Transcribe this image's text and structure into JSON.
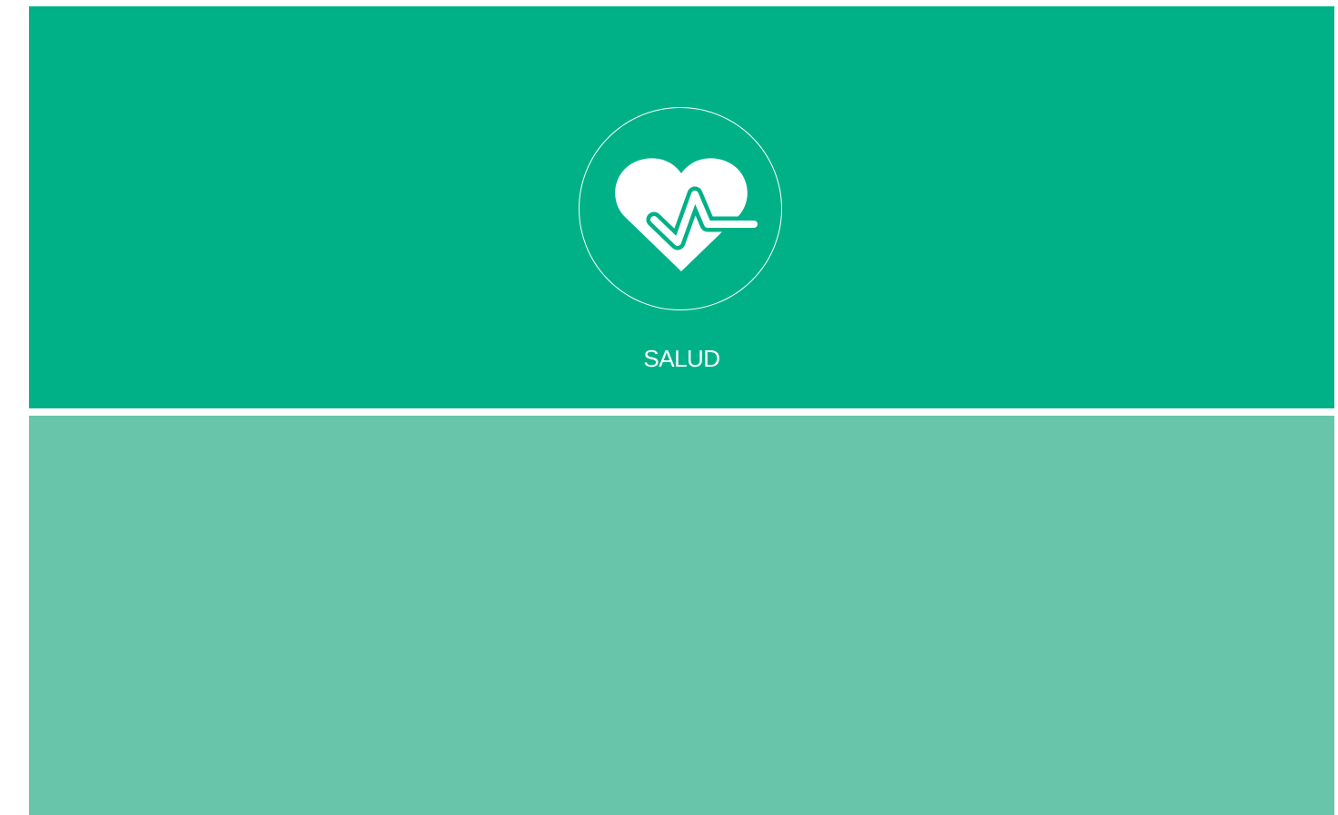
{
  "category_tile": {
    "label": "SALUD",
    "icon": "heart-pulse-icon",
    "background_color": "#00b188",
    "foreground_color": "#ffffff"
  },
  "secondary_panel": {
    "background_color": "#68c5a9"
  }
}
